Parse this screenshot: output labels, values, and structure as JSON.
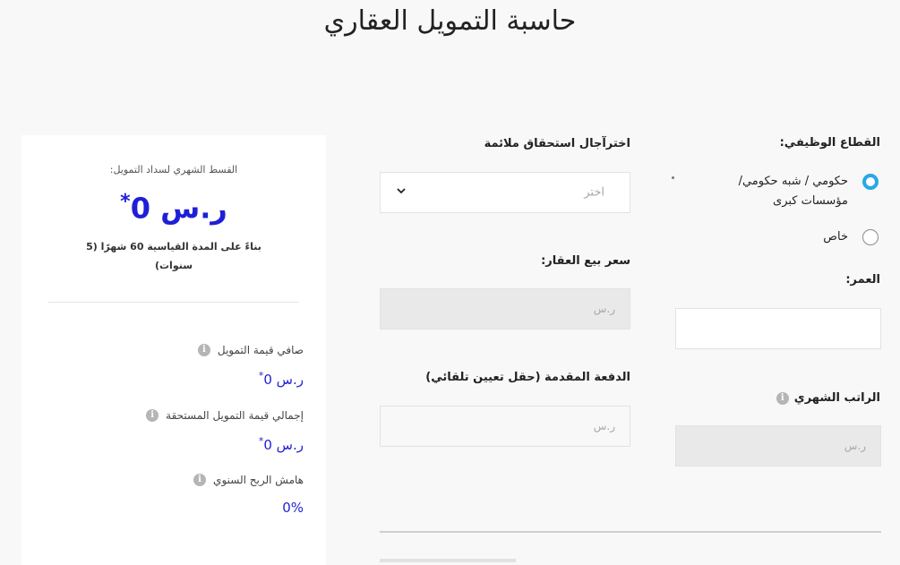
{
  "page": {
    "title": "حاسبة التمويل العقاري"
  },
  "form": {
    "sector": {
      "label": "القطاع الوظيفي:",
      "options": [
        {
          "label": "حكومي / شبه حكومي/ مؤسسات كبرى",
          "selected": true
        },
        {
          "label": "خاص",
          "selected": false
        }
      ]
    },
    "age": {
      "label": "العمر:",
      "value": ""
    },
    "salary": {
      "label": "الراتب الشهري",
      "placeholder": "ر.س"
    },
    "term": {
      "label": "اخترآجال استحقاق ملائمة",
      "placeholder": "اختر"
    },
    "price": {
      "label": "سعر بيع العقار:",
      "placeholder": "ر.س"
    },
    "down_payment": {
      "label": "الدفعة المقدمة (حقل تعيين تلقائي)",
      "placeholder": "ر.س"
    }
  },
  "summary": {
    "monthly_label": "القسط الشهري لسداد التمويل:",
    "monthly_value": "ر.س 0",
    "monthly_star": "*",
    "basis_note": "بناءً على المدة القياسية 60 شهرًا (5 سنوات)",
    "net_label": "صافي قيمة التمويل",
    "net_value": "ر.س 0",
    "net_star": "*",
    "total_label": "إجمالي قيمة التمويل المستحقة",
    "total_value": "ر.س 0",
    "total_star": "*",
    "margin_label": "هامش الربح السنوي",
    "margin_value": "0%"
  },
  "icons": {
    "info": "info-icon",
    "chevron": "chevron-down-icon"
  },
  "colors": {
    "accent": "#2aa7e6",
    "value_blue": "#1f1fd6"
  }
}
